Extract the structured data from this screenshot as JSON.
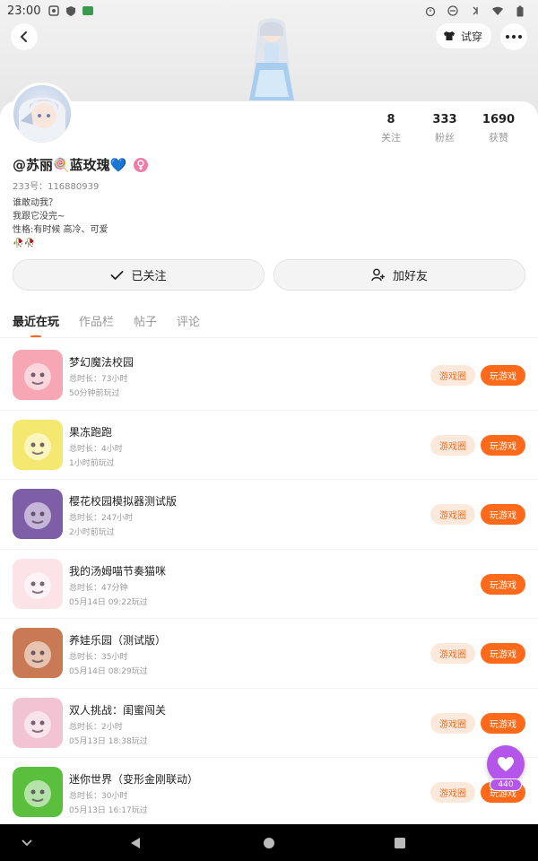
{
  "status_bar": {
    "time": "23:00"
  },
  "header": {
    "try_on_label": "试穿"
  },
  "profile": {
    "username": "@苏丽🍭蓝玫瑰💙",
    "uid": "233号：116880939",
    "bio_lines": [
      "谁敢动我？",
      "我跟它没完~",
      "性格:有时候 高冷、可爱",
      "🥀🥀"
    ],
    "stats": [
      {
        "num": "8",
        "label": "关注"
      },
      {
        "num": "333",
        "label": "粉丝"
      },
      {
        "num": "1690",
        "label": "获赞"
      }
    ]
  },
  "actions": {
    "followed_label": "已关注",
    "add_friend_label": "加好友"
  },
  "tabs": [
    "最近在玩",
    "作品栏",
    "帖子",
    "评论"
  ],
  "game_buttons": {
    "circle_label": "游戏圈",
    "play_label": "玩游戏"
  },
  "games": [
    {
      "name": "梦幻魔法校园",
      "duration": "总时长：73小时",
      "last_played": "50分钟前玩过",
      "has_circle": true,
      "icon": "magic-school-icon",
      "icon_bg": "#f7a6b4"
    },
    {
      "name": "果冻跑跑",
      "duration": "总时长：4小时",
      "last_played": "1小时前玩过",
      "has_circle": true,
      "icon": "jelly-run-icon",
      "icon_bg": "#f5e870"
    },
    {
      "name": "樱花校园模拟器测试版",
      "duration": "总时长：247小时",
      "last_played": "2小时前玩过",
      "has_circle": true,
      "icon": "sakura-school-icon",
      "icon_bg": "#7f5ea8"
    },
    {
      "name": "我的汤姆喵节奏猫咪",
      "duration": "总时长：47分钟",
      "last_played": "05月14日 09:22玩过",
      "has_circle": false,
      "icon": "tom-cat-icon",
      "icon_bg": "#fbe3e8"
    },
    {
      "name": "养娃乐园（测试版）",
      "duration": "总时长：35小时",
      "last_played": "05月14日 08:29玩过",
      "has_circle": true,
      "icon": "baby-park-icon",
      "icon_bg": "#c97a55"
    },
    {
      "name": "双人挑战：闺蜜闯关",
      "duration": "总时长：2小时",
      "last_played": "05月13日 18:38玩过",
      "has_circle": true,
      "icon": "bestie-challenge-icon",
      "icon_bg": "#f2c3d2"
    },
    {
      "name": "迷你世界（变形金刚联动）",
      "duration": "总时长：30小时",
      "last_played": "05月13日 16:17玩过",
      "has_circle": true,
      "icon": "mini-world-icon",
      "icon_bg": "#5bbf3e"
    }
  ],
  "like": {
    "count": "440"
  },
  "colors": {
    "accent": "#ff6a1a",
    "circle_bg": "#fde9dc",
    "like": "#b456ea"
  }
}
